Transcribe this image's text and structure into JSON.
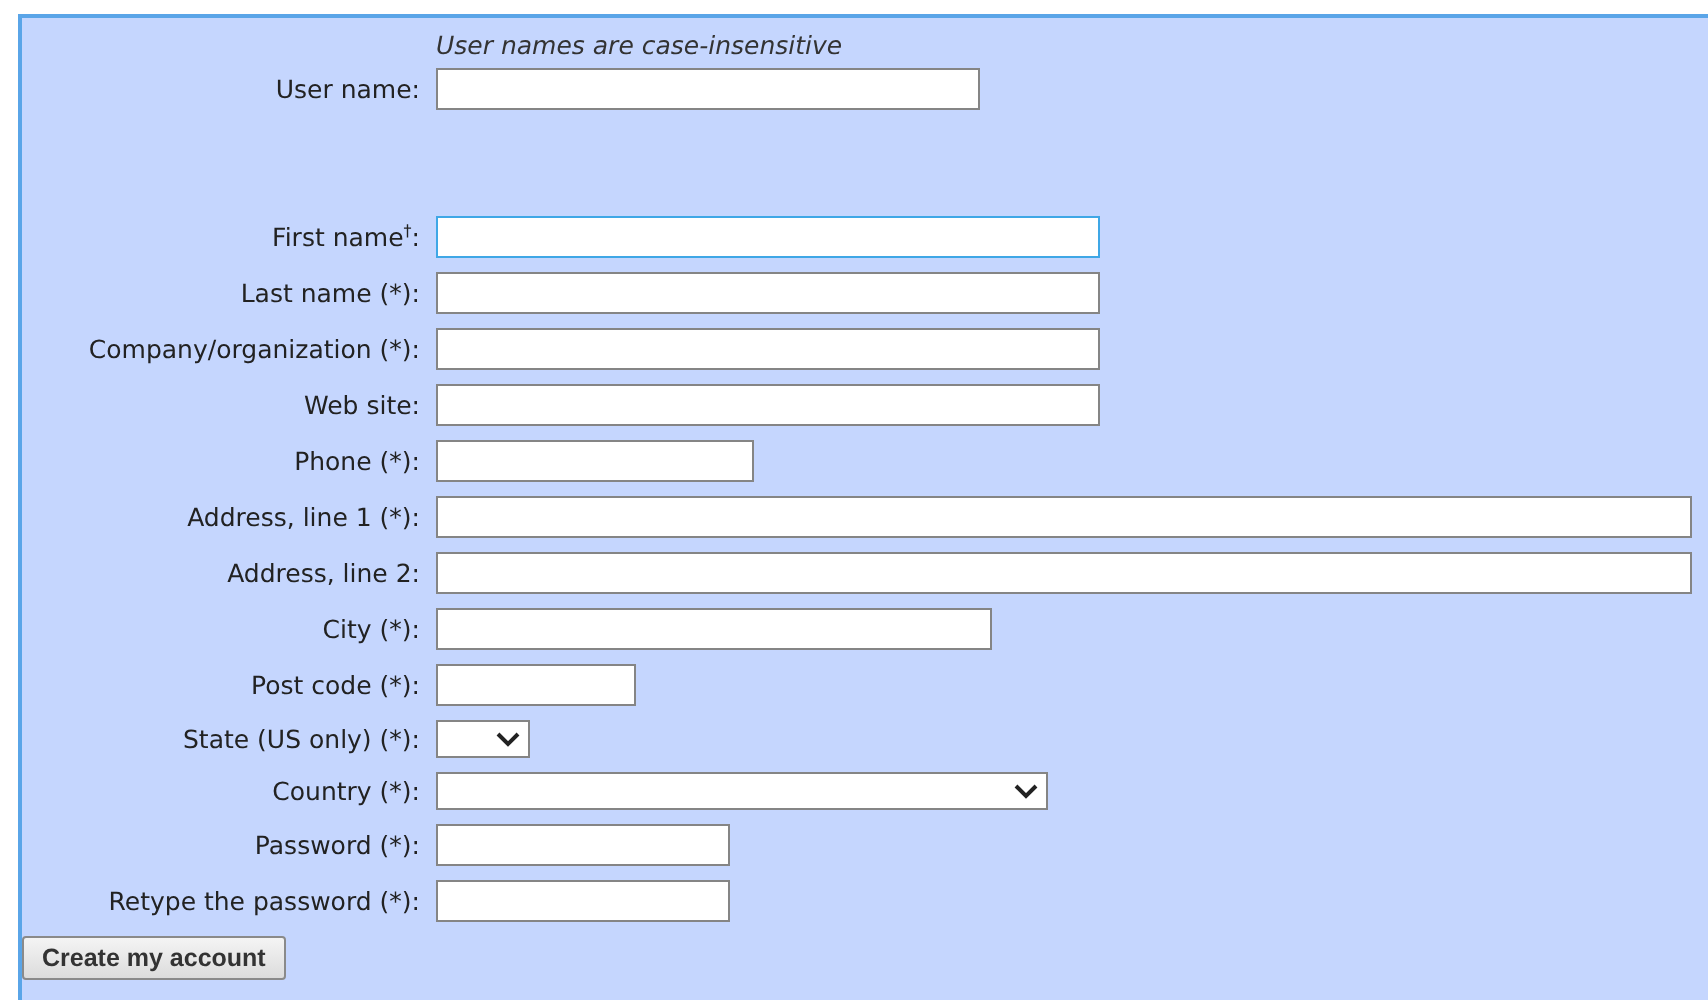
{
  "hint": "User names are case-insensitive",
  "user_field": {
    "label": "User name:",
    "kind": "text",
    "focused": false
  },
  "fields": [
    {
      "label": "First name$^{†}$:",
      "kind": "text",
      "focused": true
    },
    {
      "label": "Last name (*):",
      "kind": "text",
      "focused": false
    },
    {
      "label": "Company/organization (*):",
      "kind": "text",
      "focused": false
    },
    {
      "label": "Web site:",
      "kind": "text",
      "focused": false
    },
    {
      "label": "Phone (*):",
      "kind": "text",
      "focused": false
    },
    {
      "label": "Address, line 1 (*):",
      "kind": "text",
      "focused": false
    },
    {
      "label": "Address, line 2:",
      "kind": "text",
      "focused": false
    },
    {
      "label": "City (*):",
      "kind": "text",
      "focused": false
    },
    {
      "label": "Post code (*):",
      "kind": "text",
      "focused": false
    },
    {
      "label": "State (US only) (*):",
      "kind": "select",
      "focused": false
    },
    {
      "label": "Country (*):",
      "kind": "select",
      "focused": false
    },
    {
      "label": "Password (*):",
      "kind": "password",
      "focused": false
    },
    {
      "label": "Retype the password (*):",
      "kind": "password",
      "focused": false
    }
  ],
  "submit": "Create my account"
}
